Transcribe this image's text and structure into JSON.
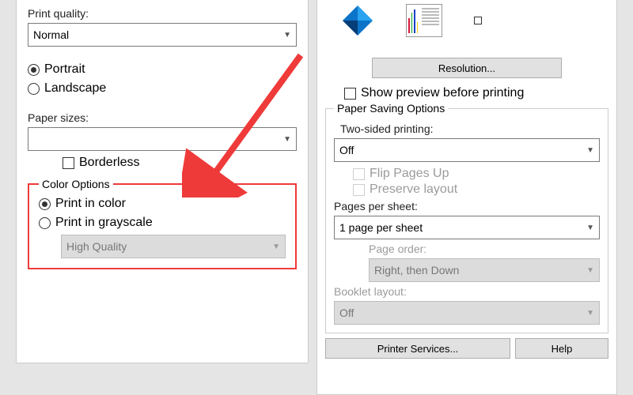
{
  "left": {
    "print_quality_label": "Print quality:",
    "print_quality_value": "Normal",
    "orientation": {
      "portrait": "Portrait",
      "landscape": "Landscape",
      "selected": "Portrait"
    },
    "paper_sizes_label": "Paper sizes:",
    "paper_sizes_value": "",
    "borderless_label": "Borderless",
    "color_options": {
      "legend": "Color Options",
      "print_color": "Print in color",
      "print_gray": "Print in grayscale",
      "gray_quality_value": "High Quality",
      "selected": "Print in color"
    }
  },
  "right": {
    "resolution_btn": "Resolution...",
    "show_preview_label": "Show preview before printing",
    "paper_saving_legend": "Paper Saving Options",
    "two_sided_label": "Two-sided printing:",
    "two_sided_value": "Off",
    "flip_pages_label": "Flip Pages Up",
    "preserve_layout_label": "Preserve layout",
    "pages_per_sheet_label": "Pages per sheet:",
    "pages_per_sheet_value": "1 page per sheet",
    "page_order_label": "Page order:",
    "page_order_value": "Right, then Down",
    "booklet_layout_label": "Booklet layout:",
    "booklet_layout_value": "Off",
    "printer_services_btn": "Printer Services...",
    "help_btn": "Help"
  }
}
